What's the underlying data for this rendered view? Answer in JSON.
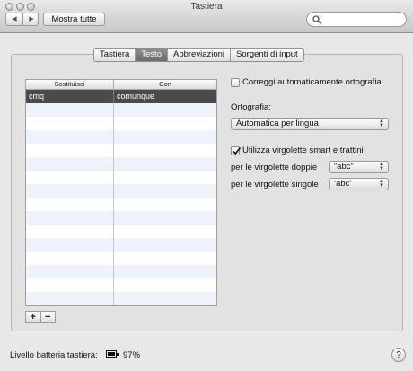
{
  "window": {
    "title": "Tastiera"
  },
  "toolbar": {
    "back_icon": "◀",
    "forward_icon": "▶",
    "show_all_label": "Mostra tutte",
    "search_placeholder": ""
  },
  "tabs": [
    {
      "label": "Tastiera",
      "active": false
    },
    {
      "label": "Testo",
      "active": true
    },
    {
      "label": "Abbreviazioni",
      "active": false
    },
    {
      "label": "Sorgenti di input",
      "active": false
    }
  ],
  "table": {
    "headers": [
      "Sostituisci",
      "Con"
    ],
    "rows": [
      {
        "replace": "cmq",
        "with": "comunque",
        "selected": true
      }
    ],
    "add_label": "+",
    "remove_label": "−"
  },
  "options": {
    "spelling_correct_label": "Correggi automaticamente ortografia",
    "spelling_correct_checked": false,
    "spelling_label": "Ortografia:",
    "spelling_value": "Automatica per lingua",
    "smart_quotes_label": "Utilizza virgolette smart e trattini",
    "smart_quotes_checked": true,
    "double_quotes_label": "per le virgolette doppie",
    "double_quotes_value": "“abc”",
    "single_quotes_label": "per le virgolette singole",
    "single_quotes_value": "‘abc’"
  },
  "footer": {
    "battery_label": "Livello batteria tastiera:",
    "battery_percent": "97%",
    "battery_level": 0.97,
    "help_label": "?"
  }
}
